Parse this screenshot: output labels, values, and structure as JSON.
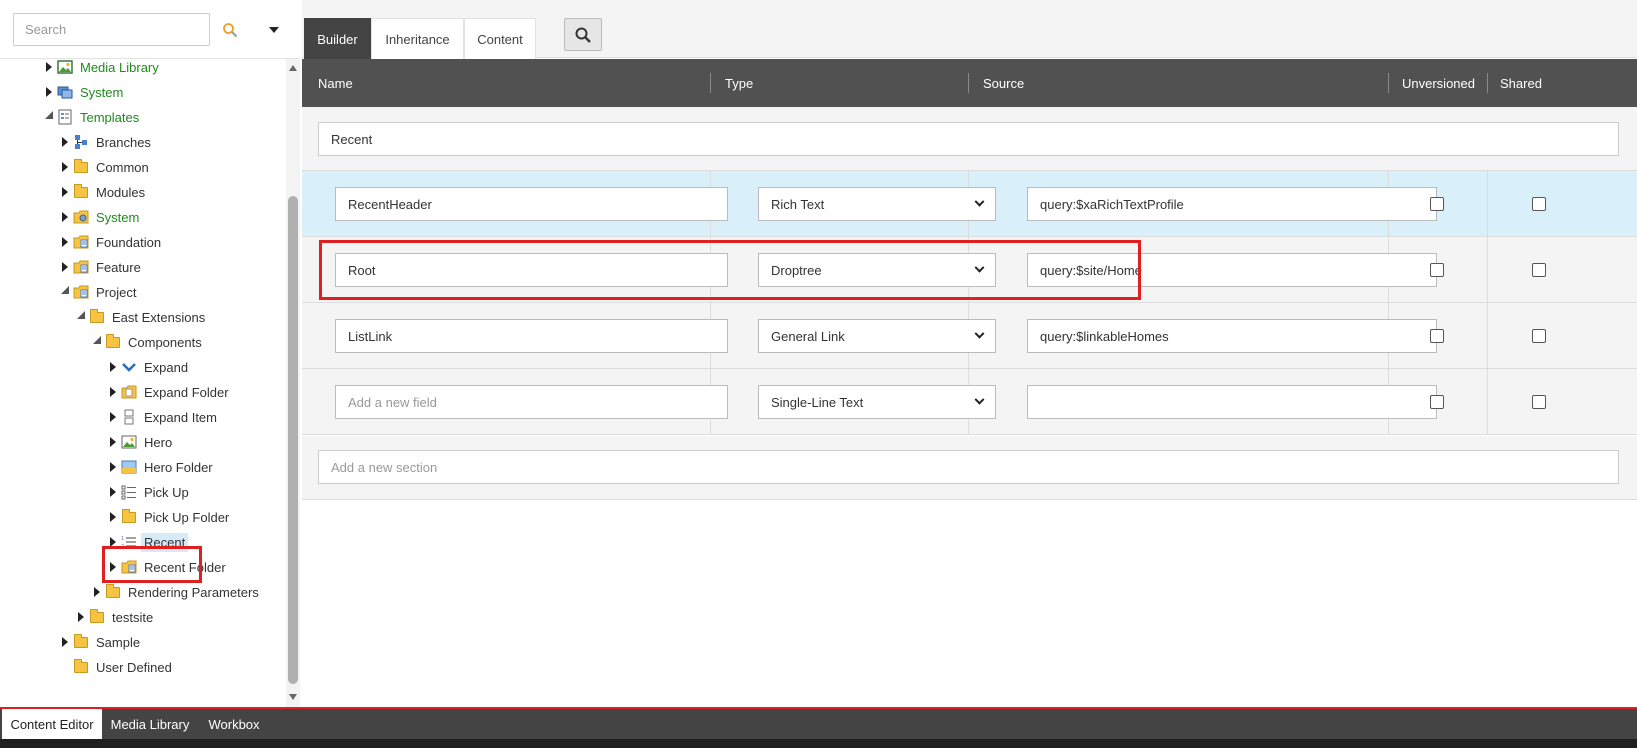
{
  "search": {
    "placeholder": "Search"
  },
  "tree": [
    {
      "label": "Media Library",
      "green": true,
      "arrow": "right",
      "icon": "media-library-icon"
    },
    {
      "label": "System",
      "green": true,
      "arrow": "right",
      "icon": "system-icon"
    },
    {
      "label": "Templates",
      "green": true,
      "arrow": "down",
      "icon": "templates-icon"
    },
    {
      "label": "Branches",
      "green": false,
      "arrow": "right",
      "icon": "branches-icon"
    },
    {
      "label": "Common",
      "green": false,
      "arrow": "right",
      "icon": "folder-icon"
    },
    {
      "label": "Modules",
      "green": false,
      "arrow": "right",
      "icon": "folder-icon"
    },
    {
      "label": "System",
      "green": true,
      "arrow": "right",
      "icon": "system-folder-icon"
    },
    {
      "label": "Foundation",
      "green": false,
      "arrow": "right",
      "icon": "template-folder-icon"
    },
    {
      "label": "Feature",
      "green": false,
      "arrow": "right",
      "icon": "template-folder-icon"
    },
    {
      "label": "Project",
      "green": false,
      "arrow": "down",
      "icon": "template-folder-icon"
    },
    {
      "label": "East Extensions",
      "green": false,
      "arrow": "down",
      "icon": "folder-icon"
    },
    {
      "label": "Components",
      "green": false,
      "arrow": "down",
      "icon": "folder-icon"
    },
    {
      "label": "Expand",
      "green": false,
      "arrow": "right",
      "icon": "chevron-down-icon"
    },
    {
      "label": "Expand Folder",
      "green": false,
      "arrow": "right",
      "icon": "folder-doc-icon"
    },
    {
      "label": "Expand Item",
      "green": false,
      "arrow": "right",
      "icon": "expand-item-icon"
    },
    {
      "label": "Hero",
      "green": false,
      "arrow": "right",
      "icon": "image-icon"
    },
    {
      "label": "Hero Folder",
      "green": false,
      "arrow": "right",
      "icon": "hero-folder-icon"
    },
    {
      "label": "Pick Up",
      "green": false,
      "arrow": "right",
      "icon": "list-icon"
    },
    {
      "label": "Pick Up Folder",
      "green": false,
      "arrow": "right",
      "icon": "folder-icon"
    },
    {
      "label": "Recent",
      "green": false,
      "arrow": "right",
      "icon": "numbered-list-icon",
      "selected": true
    },
    {
      "label": "Recent Folder",
      "green": false,
      "arrow": "right",
      "icon": "template-folder-icon"
    },
    {
      "label": "Rendering Parameters",
      "green": false,
      "arrow": "right",
      "icon": "folder-icon"
    },
    {
      "label": "testsite",
      "green": false,
      "arrow": "right",
      "icon": "folder-icon"
    },
    {
      "label": "Sample",
      "green": false,
      "arrow": "right",
      "icon": "folder-icon"
    },
    {
      "label": "User Defined",
      "green": false,
      "arrow": "none",
      "icon": "folder-icon"
    }
  ],
  "tabs": [
    {
      "label": "Builder",
      "active": true
    },
    {
      "label": "Inheritance",
      "active": false
    },
    {
      "label": "Content",
      "active": false
    }
  ],
  "columns": {
    "name": "Name",
    "type": "Type",
    "source": "Source",
    "unversioned": "Unversioned",
    "shared": "Shared"
  },
  "section": {
    "name": "Recent"
  },
  "fields": [
    {
      "name": "RecentHeader",
      "type": "Rich Text",
      "source": "query:$xaRichTextProfile",
      "unversioned": false,
      "shared": false
    },
    {
      "name": "Root",
      "type": "Droptree",
      "source": "query:$site/Home",
      "unversioned": false,
      "shared": false
    },
    {
      "name": "ListLink",
      "type": "General Link",
      "source": "query:$linkableHomes",
      "unversioned": false,
      "shared": false
    }
  ],
  "new_field": {
    "placeholder": "Add a new field",
    "type": "Single-Line Text",
    "source": ""
  },
  "new_section": {
    "placeholder": "Add a new section"
  },
  "bottom_tabs": [
    {
      "label": "Content Editor",
      "active": true
    },
    {
      "label": "Media Library",
      "active": false
    },
    {
      "label": "Workbox",
      "active": false
    }
  ],
  "colors": {
    "accent_red": "#e02020",
    "header_gray": "#515151",
    "highlight_row": "#d9effa",
    "tree_green": "#1f8a1f"
  }
}
